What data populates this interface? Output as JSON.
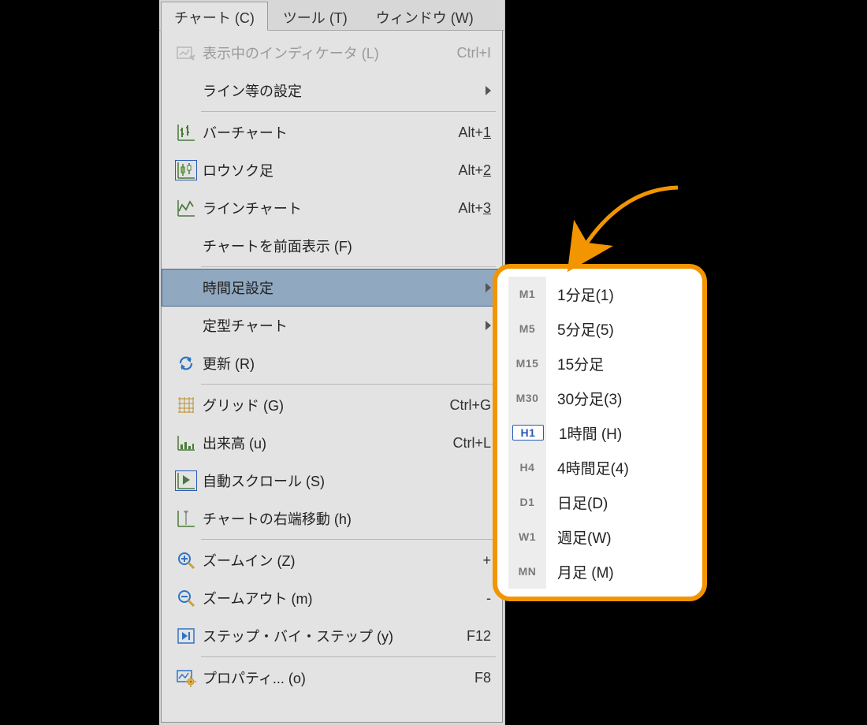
{
  "menubar": {
    "chart": "チャート (C)",
    "tools": "ツール (T)",
    "window": "ウィンドウ (W)"
  },
  "menu": {
    "indicators_label": "表示中のインディケータ (L)",
    "indicators_shortcut": "Ctrl+I",
    "lines_label": "ライン等の設定",
    "bar_label": "バーチャート",
    "bar_shortcut_prefix": "Alt+",
    "bar_shortcut_u": "1",
    "candle_label": "ロウソク足",
    "candle_shortcut_prefix": "Alt+",
    "candle_shortcut_u": "2",
    "line_label": "ラインチャート",
    "line_shortcut_prefix": "Alt+",
    "line_shortcut_u": "3",
    "foreground_label": "チャートを前面表示 (F)",
    "timeframe_label": "時間足設定",
    "template_label": "定型チャート",
    "refresh_label": "更新 (R)",
    "grid_label": "グリッド (G)",
    "grid_shortcut": "Ctrl+G",
    "volume_label": "出来高 (u)",
    "volume_shortcut": "Ctrl+L",
    "autoscroll_label": "自動スクロール (S)",
    "shift_label": "チャートの右端移動 (h)",
    "zoomin_label": "ズームイン (Z)",
    "zoomin_shortcut": "+",
    "zoomout_label": "ズームアウト (m)",
    "zoomout_shortcut": "-",
    "step_label": "ステップ・バイ・ステップ (y)",
    "step_shortcut": "F12",
    "properties_label": "プロパティ... (o)",
    "properties_shortcut": "F8"
  },
  "timeframes": [
    {
      "code": "M1",
      "label": "1分足(1)"
    },
    {
      "code": "M5",
      "label": "5分足(5)"
    },
    {
      "code": "M15",
      "label": "15分足"
    },
    {
      "code": "M30",
      "label": "30分足(3)"
    },
    {
      "code": "H1",
      "label": "1時間 (H)"
    },
    {
      "code": "H4",
      "label": "4時間足(4)"
    },
    {
      "code": "D1",
      "label": "日足(D)"
    },
    {
      "code": "W1",
      "label": "週足(W)"
    },
    {
      "code": "MN",
      "label": "月足 (M)"
    }
  ],
  "timeframe_selected_index": 4,
  "annotation": {
    "arrow_color": "#f29500"
  }
}
